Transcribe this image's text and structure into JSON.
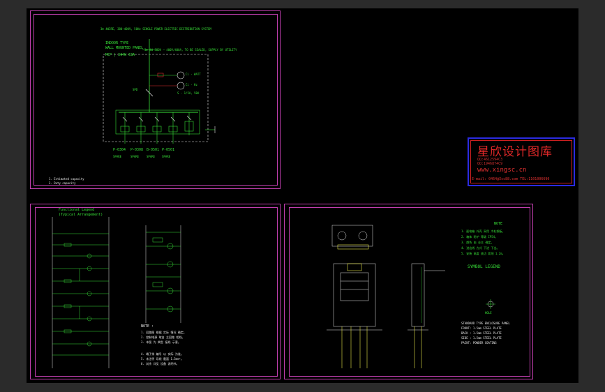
{
  "sheet1": {
    "title": "3Φ 4WIRE, 380~400V, 50Hz SINGLE POWER ELECTRIC DISTRIBUTION SYSTEM",
    "panel_label_1": "INDOOR TYPE",
    "panel_label_2": "WALL MOUNTED PANEL",
    "panel_label_3": "MCP | 3Φ4W 63A",
    "top_note": "3Φ 4W 380V ~ 400V/400A, TO BE SEALED, SUPPLY BY UTILITY",
    "meter_note_1": "Ci - WATT",
    "meter_note_2": "Ci - Hz",
    "meter_note_3": "S - 1/5A, 50A",
    "spd": "SPD",
    "feeders": [
      "P-0304",
      "P-0308",
      "B-0501",
      "P-0501"
    ],
    "feeder_sub": [
      "SPARE",
      "SPARE",
      "SPARE",
      "SPARE"
    ],
    "legend_1": "1. Estimated capacity",
    "legend_2": "2. Duty capacity"
  },
  "sheet2": {
    "title_1": "Functional Legend",
    "title_2": "(Typical Arrangement)",
    "notes_title": "NOTE :",
    "notes": [
      "1. 回路图 根据 实际 情况 确定。",
      "2. 控制电源 取自 主回路 相线。",
      "3. 本图 为 典型 接线 示意。",
      "4. 端子排 编号 以 实际 为准。",
      "5. 未注明 导线 截面 1.5mm²。",
      "6. 其余 详见 设备 说明书。"
    ]
  },
  "sheet3": {
    "notes_title": "NOTE",
    "legend_title": "SYMBOL LEGEND",
    "hole_label": "HOLE",
    "notes_text": [
      "1. 配电箱 外壳 采用 冷轧钢板。",
      "2. 箱体 防护 等级 IP54。",
      "3. 颜色 由 业主 确定。",
      "4. 进出线 方式 下进 下出。",
      "5. 安装 高度 底边 距地 1.2m。"
    ],
    "spec_text": [
      "STANDARD TYPE ENCLOSURE PANEL",
      "FRONT: 1.5mm STEEL PLATE",
      "BACK : 1.5mm STEEL PLATE",
      "SIDE : 1.5mm STEEL PLATE",
      "PAINT: POWDER COATING"
    ]
  },
  "watermark": {
    "title": "星欣设计图库",
    "qq_1": "QQ:4612594C3",
    "qq_2": "QQ:1946874C9",
    "url": "www.xingsc.cn",
    "mail": "E-mail: 0464@Xsc88.com  TEL:1101006690"
  },
  "colors": {
    "background": "#000000",
    "frame": "#c23fb0",
    "wire": "#38e038",
    "label": "#e8e8e8",
    "watermark_red": "#e02828",
    "watermark_blue": "#2b2be0"
  }
}
